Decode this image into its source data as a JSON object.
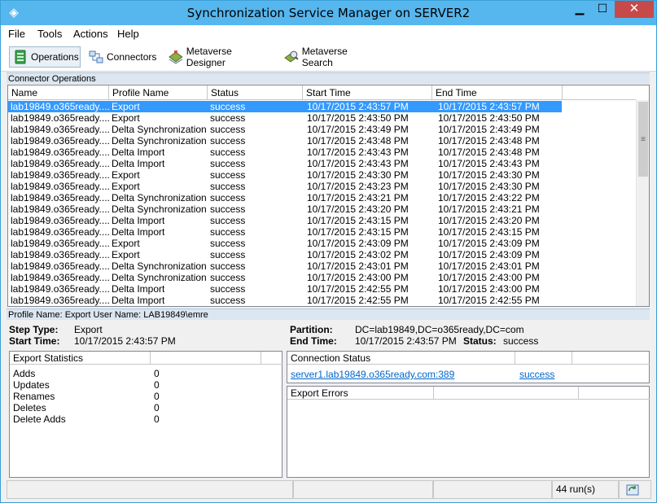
{
  "window": {
    "title": "Synchronization Service Manager on SERVER2",
    "min": "▁",
    "max": "☐",
    "close": "✕"
  },
  "menu": [
    "File",
    "Tools",
    "Actions",
    "Help"
  ],
  "toolbar": [
    "Operations",
    "Connectors",
    "Metaverse Designer",
    "Metaverse Search"
  ],
  "connector_ops": {
    "title": "Connector Operations",
    "columns": [
      "Name",
      "Profile Name",
      "Status",
      "Start Time",
      "End Time"
    ],
    "rows": [
      [
        "lab19849.o365ready....",
        "Export",
        "success",
        "10/17/2015 2:43:57 PM",
        "10/17/2015 2:43:57 PM"
      ],
      [
        "lab19849.o365ready....",
        "Export",
        "success",
        "10/17/2015 2:43:50 PM",
        "10/17/2015 2:43:50 PM"
      ],
      [
        "lab19849.o365ready....",
        "Delta Synchronization",
        "success",
        "10/17/2015 2:43:49 PM",
        "10/17/2015 2:43:49 PM"
      ],
      [
        "lab19849.o365ready....",
        "Delta Synchronization",
        "success",
        "10/17/2015 2:43:48 PM",
        "10/17/2015 2:43:48 PM"
      ],
      [
        "lab19849.o365ready....",
        "Delta Import",
        "success",
        "10/17/2015 2:43:43 PM",
        "10/17/2015 2:43:48 PM"
      ],
      [
        "lab19849.o365ready....",
        "Delta Import",
        "success",
        "10/17/2015 2:43:43 PM",
        "10/17/2015 2:43:43 PM"
      ],
      [
        "lab19849.o365ready....",
        "Export",
        "success",
        "10/17/2015 2:43:30 PM",
        "10/17/2015 2:43:30 PM"
      ],
      [
        "lab19849.o365ready....",
        "Export",
        "success",
        "10/17/2015 2:43:23 PM",
        "10/17/2015 2:43:30 PM"
      ],
      [
        "lab19849.o365ready....",
        "Delta Synchronization",
        "success",
        "10/17/2015 2:43:21 PM",
        "10/17/2015 2:43:22 PM"
      ],
      [
        "lab19849.o365ready....",
        "Delta Synchronization",
        "success",
        "10/17/2015 2:43:20 PM",
        "10/17/2015 2:43:21 PM"
      ],
      [
        "lab19849.o365ready....",
        "Delta Import",
        "success",
        "10/17/2015 2:43:15 PM",
        "10/17/2015 2:43:20 PM"
      ],
      [
        "lab19849.o365ready....",
        "Delta Import",
        "success",
        "10/17/2015 2:43:15 PM",
        "10/17/2015 2:43:15 PM"
      ],
      [
        "lab19849.o365ready....",
        "Export",
        "success",
        "10/17/2015 2:43:09 PM",
        "10/17/2015 2:43:09 PM"
      ],
      [
        "lab19849.o365ready....",
        "Export",
        "success",
        "10/17/2015 2:43:02 PM",
        "10/17/2015 2:43:09 PM"
      ],
      [
        "lab19849.o365ready....",
        "Delta Synchronization",
        "success",
        "10/17/2015 2:43:01 PM",
        "10/17/2015 2:43:01 PM"
      ],
      [
        "lab19849.o365ready....",
        "Delta Synchronization",
        "success",
        "10/17/2015 2:43:00 PM",
        "10/17/2015 2:43:00 PM"
      ],
      [
        "lab19849.o365ready....",
        "Delta Import",
        "success",
        "10/17/2015 2:42:55 PM",
        "10/17/2015 2:43:00 PM"
      ],
      [
        "lab19849.o365ready....",
        "Delta Import",
        "success",
        "10/17/2015 2:42:55 PM",
        "10/17/2015 2:42:55 PM"
      ]
    ]
  },
  "details": {
    "profile_bar": "Profile Name: Export  User Name: LAB19849\\emre",
    "step_type_label": "Step Type:",
    "step_type": "Export",
    "start_time_label": "Start Time:",
    "start_time": "10/17/2015 2:43:57 PM",
    "partition_label": "Partition:",
    "partition": "DC=lab19849,DC=o365ready,DC=com",
    "end_time_label": "End Time:",
    "end_time": "10/17/2015 2:43:57 PM",
    "status_label": "Status:",
    "status": "success"
  },
  "export_stats": {
    "title": "Export Statistics",
    "rows": [
      [
        "Adds",
        "0"
      ],
      [
        "Updates",
        "0"
      ],
      [
        "Renames",
        "0"
      ],
      [
        "Deletes",
        "0"
      ],
      [
        "Delete Adds",
        "0"
      ]
    ]
  },
  "connection_status": {
    "title": "Connection Status",
    "server": "server1.lab19849.o365ready.com:389",
    "result": "success"
  },
  "export_errors": {
    "title": "Export Errors"
  },
  "statusbar": {
    "runs": "44 run(s)"
  }
}
